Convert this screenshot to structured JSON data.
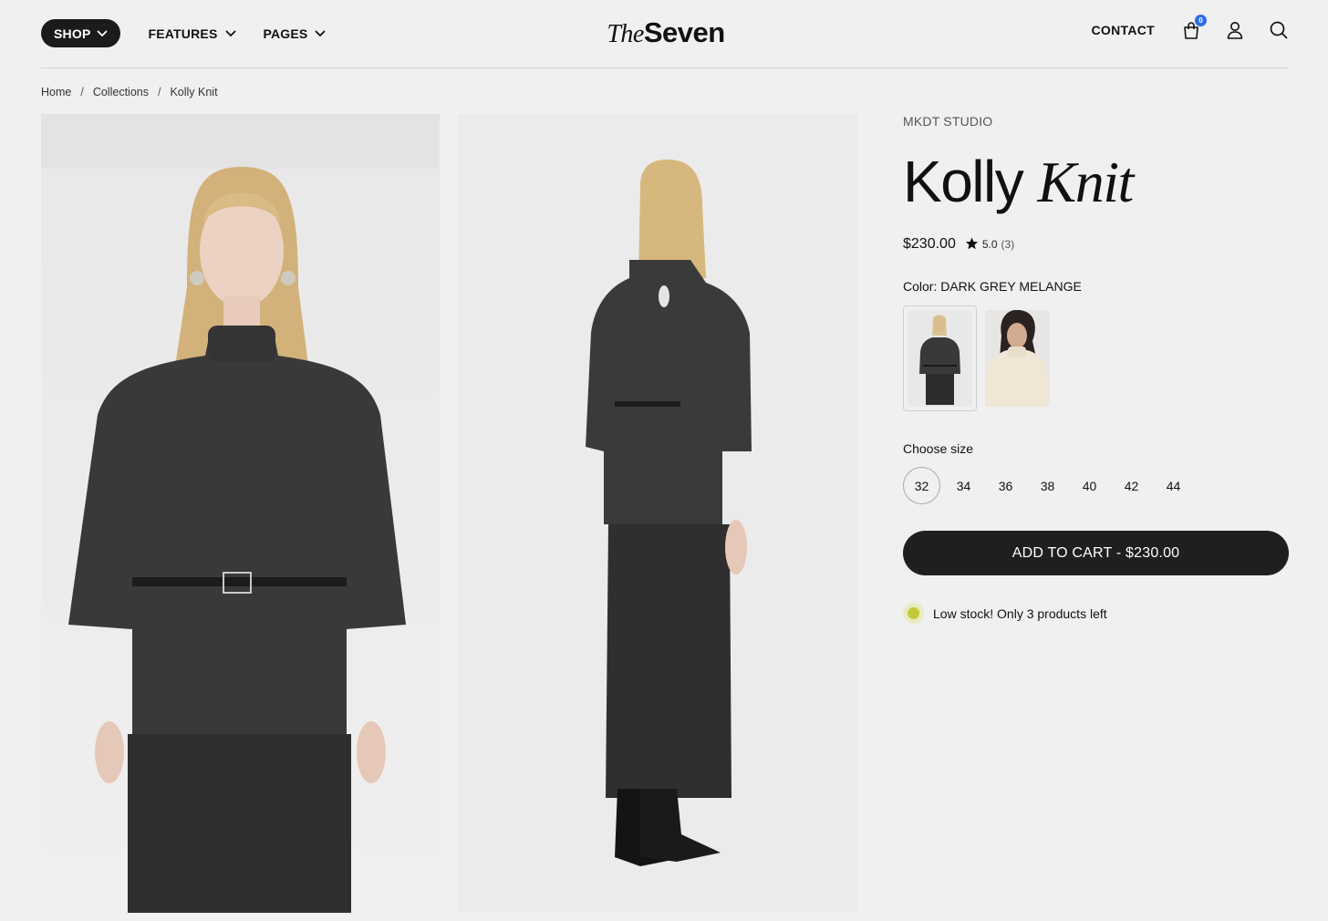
{
  "header": {
    "nav": {
      "shop_label": "SHOP",
      "features_label": "FEATURES",
      "pages_label": "PAGES"
    },
    "logo": {
      "part1": "The",
      "part2": "Seven"
    },
    "contact_label": "CONTACT",
    "cart_count": "0",
    "icons": [
      "cart-icon",
      "user-icon",
      "search-icon"
    ]
  },
  "breadcrumb": {
    "home": "Home",
    "collections": "Collections",
    "current": "Kolly Knit",
    "separator": "/"
  },
  "product": {
    "brand": "MKDT STUDIO",
    "title_plain": "Kolly",
    "title_italic": "Knit",
    "price": "$230.00",
    "rating": "5.0",
    "review_count": "(3)",
    "color_label": "Color: DARK GREY MELANGE",
    "size_label": "Choose size",
    "sizes": [
      "32",
      "34",
      "36",
      "38",
      "40",
      "42",
      "44"
    ],
    "selected_size": "32",
    "add_to_cart": "ADD TO CART - $230.00",
    "stock_message": "Low stock! Only 3 products left"
  },
  "colors": {
    "accent": "#1f1f1f",
    "badge": "#2f6de1",
    "stock_dot": "#c4c83c",
    "background": "#f1f0f0"
  }
}
